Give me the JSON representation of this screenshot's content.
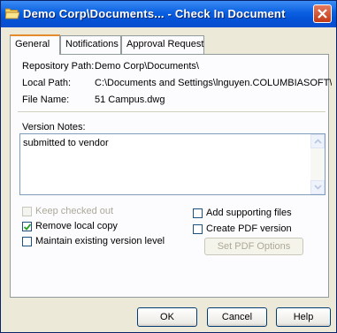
{
  "window": {
    "title": "Demo Corp\\Documents... - Check In Document"
  },
  "tabs": [
    {
      "label": "General",
      "active": true
    },
    {
      "label": "Notifications",
      "active": false
    },
    {
      "label": "Approval Request",
      "active": false
    }
  ],
  "info": {
    "repository_label": "Repository Path:",
    "repository_value": "Demo Corp\\Documents\\",
    "local_label": "Local Path:",
    "local_value": "C:\\Documents and Settings\\lnguyen.COLUMBIASOFT\\M",
    "file_label": "File Name:",
    "file_value": "51 Campus.dwg"
  },
  "notes": {
    "label": "Version Notes:",
    "value": "submitted to vendor"
  },
  "options": {
    "keep_checked_out": {
      "label": "Keep checked out",
      "checked": false,
      "enabled": false
    },
    "remove_local_copy": {
      "label": "Remove local copy",
      "checked": true,
      "enabled": true
    },
    "maintain_version": {
      "label": "Maintain existing version level",
      "checked": false,
      "enabled": true
    },
    "add_supporting": {
      "label": "Add supporting files",
      "checked": false,
      "enabled": true
    },
    "create_pdf": {
      "label": "Create PDF version",
      "checked": false,
      "enabled": true
    },
    "set_pdf_options_label": "Set PDF Options"
  },
  "buttons": {
    "ok": "OK",
    "cancel": "Cancel",
    "help": "Help"
  }
}
